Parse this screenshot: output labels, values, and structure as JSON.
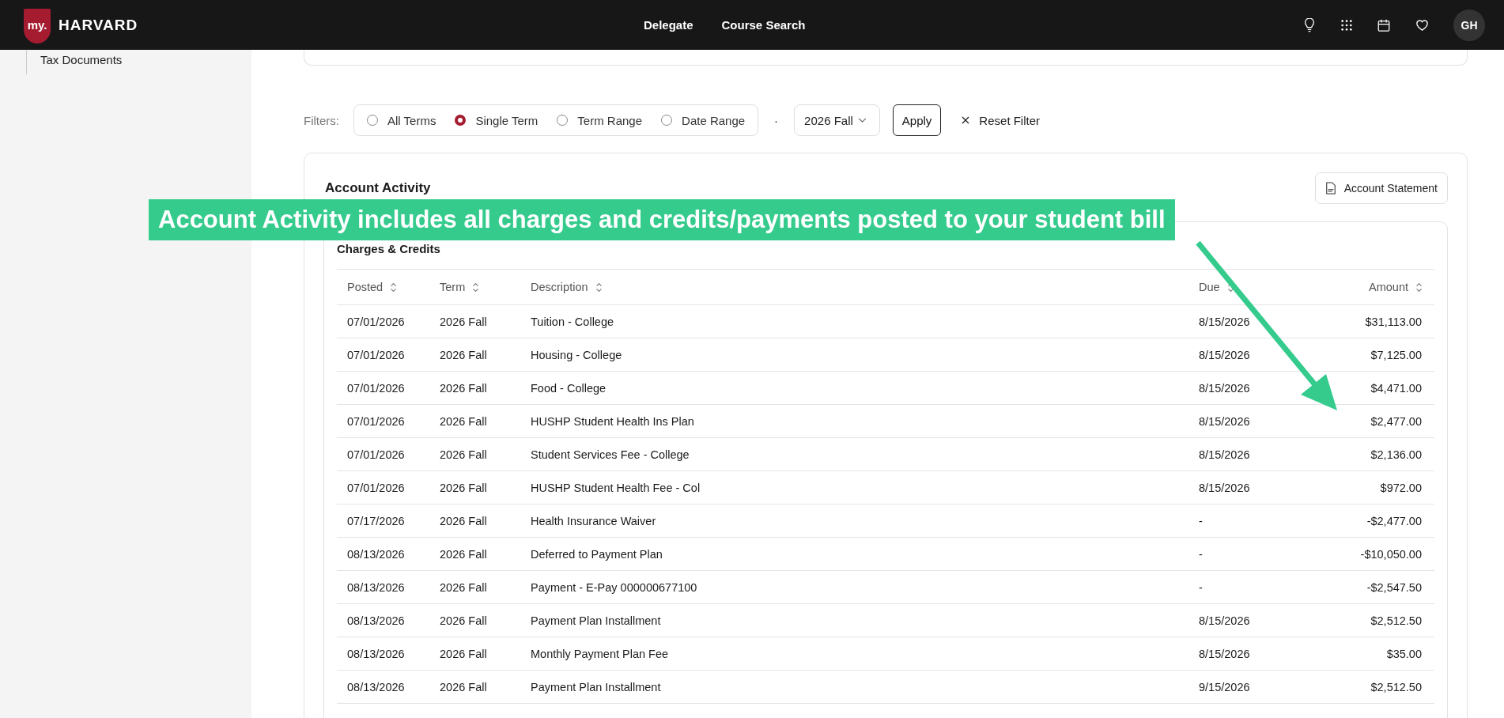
{
  "header": {
    "logo_mark": "my.",
    "logo_name": "HARVARD",
    "nav": [
      "Delegate",
      "Course Search"
    ],
    "avatar": "GH"
  },
  "sidebar": {
    "items": [
      {
        "label": "Tax Documents"
      }
    ]
  },
  "filters": {
    "label": "Filters:",
    "options": [
      {
        "label": "All Terms",
        "selected": false
      },
      {
        "label": "Single Term",
        "selected": true
      },
      {
        "label": "Term Range",
        "selected": false
      },
      {
        "label": "Date Range",
        "selected": false
      }
    ],
    "separator": "·",
    "term_select": "2026 Fall",
    "apply": "Apply",
    "reset": "Reset Filter"
  },
  "activity": {
    "title": "Account Activity",
    "statement_button": "Account Statement",
    "callout": "Account Activity includes all charges and credits/payments posted to your student bill",
    "charges": {
      "title": "Charges & Credits",
      "columns": [
        "Posted",
        "Term",
        "Description",
        "Due",
        "Amount"
      ],
      "rows": [
        [
          "07/01/2026",
          "2026 Fall",
          "Tuition - College",
          "8/15/2026",
          "$31,113.00"
        ],
        [
          "07/01/2026",
          "2026 Fall",
          "Housing - College",
          "8/15/2026",
          "$7,125.00"
        ],
        [
          "07/01/2026",
          "2026 Fall",
          "Food - College",
          "8/15/2026",
          "$4,471.00"
        ],
        [
          "07/01/2026",
          "2026 Fall",
          "HUSHP Student Health Ins Plan",
          "8/15/2026",
          "$2,477.00"
        ],
        [
          "07/01/2026",
          "2026 Fall",
          "Student Services Fee - College",
          "8/15/2026",
          "$2,136.00"
        ],
        [
          "07/01/2026",
          "2026 Fall",
          "HUSHP Student Health Fee - Col",
          "8/15/2026",
          "$972.00"
        ],
        [
          "07/17/2026",
          "2026 Fall",
          "Health Insurance Waiver",
          "-",
          "-$2,477.00"
        ],
        [
          "08/13/2026",
          "2026 Fall",
          "Deferred to Payment Plan",
          "-",
          "-$10,050.00"
        ],
        [
          "08/13/2026",
          "2026 Fall",
          "Payment - E-Pay 000000677100",
          "-",
          "-$2,547.50"
        ],
        [
          "08/13/2026",
          "2026 Fall",
          "Payment Plan Installment",
          "8/15/2026",
          "$2,512.50"
        ],
        [
          "08/13/2026",
          "2026 Fall",
          "Monthly Payment Plan Fee",
          "8/15/2026",
          "$35.00"
        ],
        [
          "08/13/2026",
          "2026 Fall",
          "Payment Plan Installment",
          "9/15/2026",
          "$2,512.50"
        ]
      ]
    }
  }
}
